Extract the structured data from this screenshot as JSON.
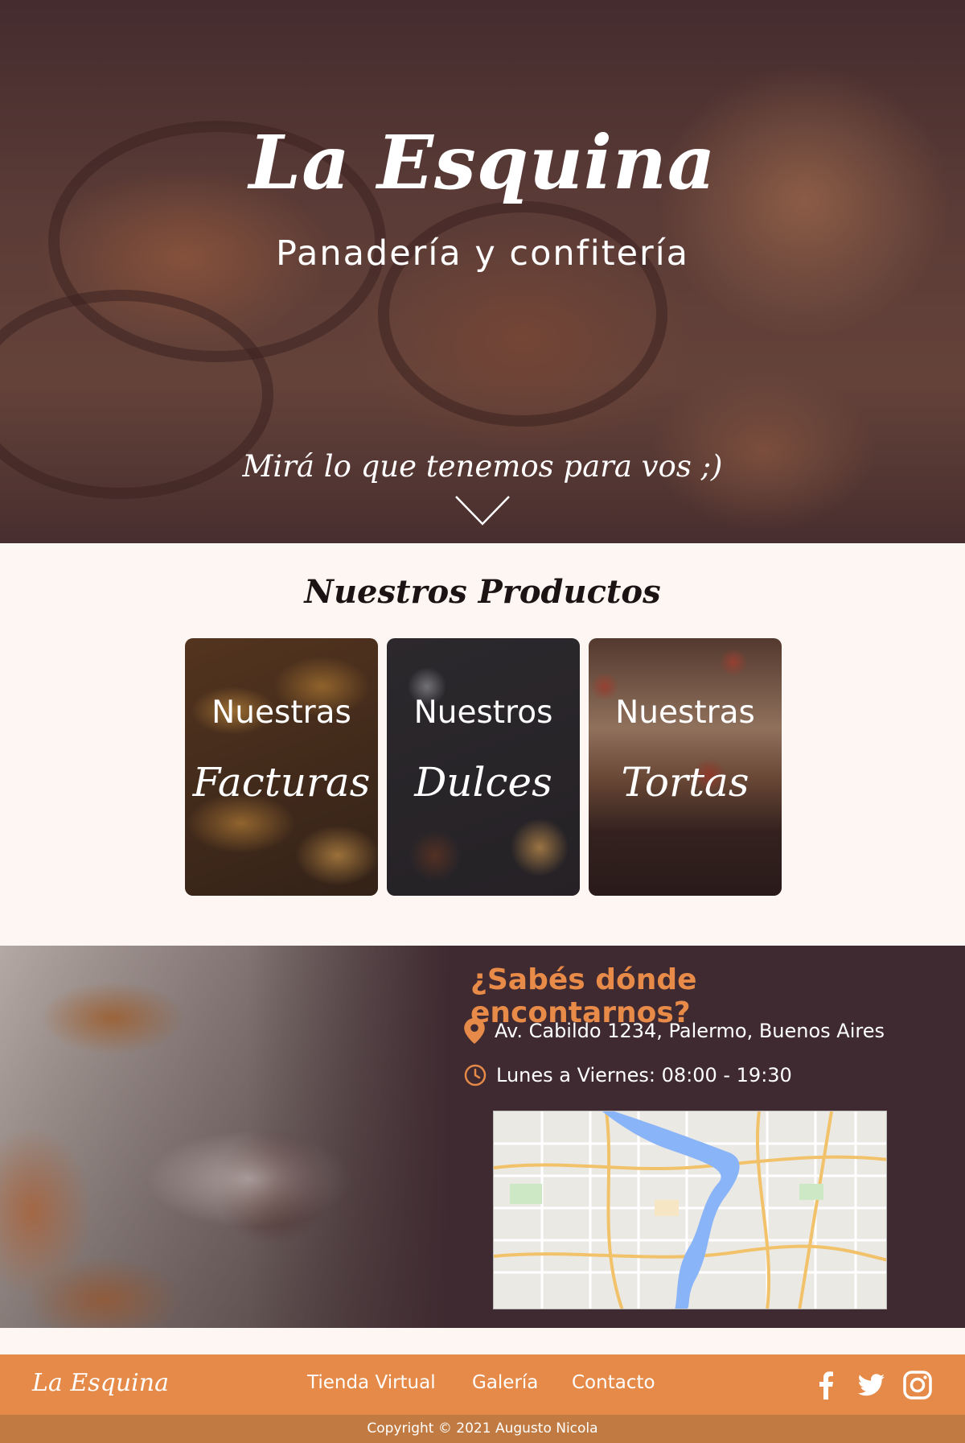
{
  "hero": {
    "title": "La Esquina",
    "subtitle": "Panadería y confitería",
    "cta": "Mirá lo que tenemos para vos ;)"
  },
  "products": {
    "title": "Nuestros Productos",
    "cards": [
      {
        "label": "Nuestras",
        "name": "Facturas"
      },
      {
        "label": "Nuestros",
        "name": "Dulces"
      },
      {
        "label": "Nuestras",
        "name": "Tortas"
      }
    ]
  },
  "location": {
    "title": "¿Sabés dónde encontarnos?",
    "address": "Av. Cabildo 1234, Palermo, Buenos Aires",
    "hours": "Lunes a Viernes: 08:00 - 19:30"
  },
  "footer": {
    "logo": "La Esquina",
    "links": [
      "Tienda Virtual",
      "Galería",
      "Contacto"
    ],
    "social": [
      "facebook-icon",
      "twitter-icon",
      "instagram-icon"
    ],
    "copyright": "Copyright © 2021 Augusto Nicola"
  },
  "colors": {
    "accent": "#e58a48",
    "dark": "#3e2a30",
    "background": "#fdf6f2"
  }
}
